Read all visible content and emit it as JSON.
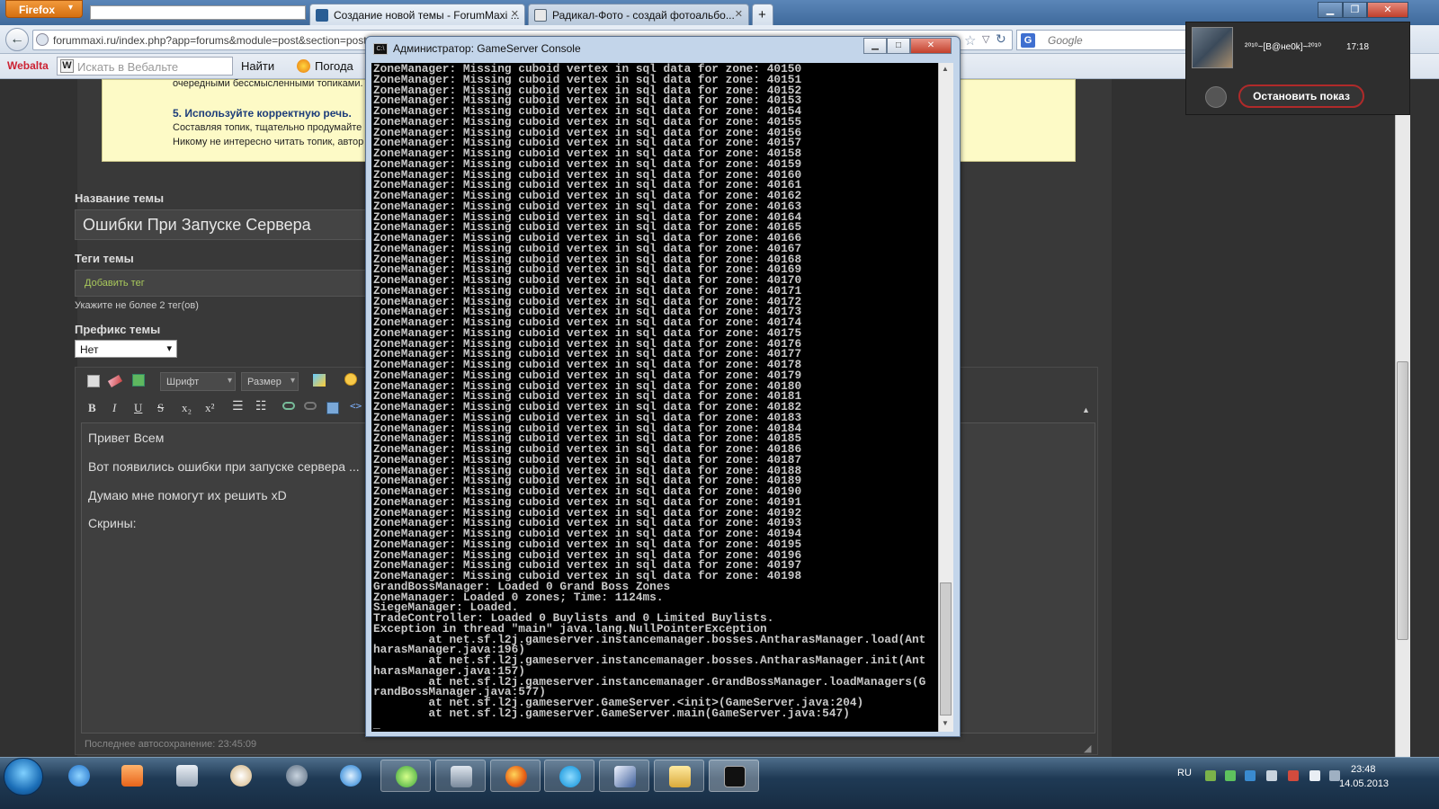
{
  "browser": {
    "menu_label": "Firefox",
    "tabs": [
      {
        "label": "Создание новой темы - ForumMaxi ..."
      },
      {
        "label": "Радикал-Фото - создай фотоальбо..."
      }
    ],
    "new_tab_label": "+",
    "url": "forummaxi.ru/index.php?app=forums&module=post&section=post",
    "search_engine": "Google",
    "search_placeholder": "Google",
    "toolbar": {
      "webalta": "Webalta",
      "webalta_placeholder": "Искать в Вебальте",
      "find": "Найти",
      "weather": "Погода"
    }
  },
  "forum": {
    "rules": {
      "line1": "очередными бессмысленными топиками.",
      "heading5": "5. Используйте корректную речь.",
      "line2": "Составляя топик, тщательно продумайте",
      "line3": "Никому не интересно читать топик, автор"
    },
    "title_label": "Название темы",
    "title_value": "Ошибки При Запуске Сервера",
    "tags_label": "Теги темы",
    "tags_placeholder": "Добавить тег",
    "tags_hint": "Укажите не более 2 тег(ов)",
    "prefix_label": "Префикс темы",
    "prefix_value": "Нет",
    "toolbar": {
      "font": "Шрифт",
      "size": "Размер",
      "bold": "B",
      "italic": "I",
      "underline": "U",
      "strike": "S",
      "sub": "x₂",
      "sup": "x²"
    },
    "body": [
      "Привет Всем",
      "Вот появились ошибки при запуске сервера ...",
      "Думаю мне помогут их решить xD",
      "Скрины:"
    ],
    "autosave": "Последнее автосохранение: 23:45:09"
  },
  "share": {
    "name": "²⁰¹⁰~[B@нe0k]~²⁰¹⁰",
    "time": "17:18",
    "stop_button": "Остановить показ"
  },
  "console": {
    "title": "Администратор:  GameServer Console",
    "lines": [
      "ZoneManager: Missing cuboid vertex in sql data for zone: 40150",
      "ZoneManager: Missing cuboid vertex in sql data for zone: 40151",
      "ZoneManager: Missing cuboid vertex in sql data for zone: 40152",
      "ZoneManager: Missing cuboid vertex in sql data for zone: 40153",
      "ZoneManager: Missing cuboid vertex in sql data for zone: 40154",
      "ZoneManager: Missing cuboid vertex in sql data for zone: 40155",
      "ZoneManager: Missing cuboid vertex in sql data for zone: 40156",
      "ZoneManager: Missing cuboid vertex in sql data for zone: 40157",
      "ZoneManager: Missing cuboid vertex in sql data for zone: 40158",
      "ZoneManager: Missing cuboid vertex in sql data for zone: 40159",
      "ZoneManager: Missing cuboid vertex in sql data for zone: 40160",
      "ZoneManager: Missing cuboid vertex in sql data for zone: 40161",
      "ZoneManager: Missing cuboid vertex in sql data for zone: 40162",
      "ZoneManager: Missing cuboid vertex in sql data for zone: 40163",
      "ZoneManager: Missing cuboid vertex in sql data for zone: 40164",
      "ZoneManager: Missing cuboid vertex in sql data for zone: 40165",
      "ZoneManager: Missing cuboid vertex in sql data for zone: 40166",
      "ZoneManager: Missing cuboid vertex in sql data for zone: 40167",
      "ZoneManager: Missing cuboid vertex in sql data for zone: 40168",
      "ZoneManager: Missing cuboid vertex in sql data for zone: 40169",
      "ZoneManager: Missing cuboid vertex in sql data for zone: 40170",
      "ZoneManager: Missing cuboid vertex in sql data for zone: 40171",
      "ZoneManager: Missing cuboid vertex in sql data for zone: 40172",
      "ZoneManager: Missing cuboid vertex in sql data for zone: 40173",
      "ZoneManager: Missing cuboid vertex in sql data for zone: 40174",
      "ZoneManager: Missing cuboid vertex in sql data for zone: 40175",
      "ZoneManager: Missing cuboid vertex in sql data for zone: 40176",
      "ZoneManager: Missing cuboid vertex in sql data for zone: 40177",
      "ZoneManager: Missing cuboid vertex in sql data for zone: 40178",
      "ZoneManager: Missing cuboid vertex in sql data for zone: 40179",
      "ZoneManager: Missing cuboid vertex in sql data for zone: 40180",
      "ZoneManager: Missing cuboid vertex in sql data for zone: 40181",
      "ZoneManager: Missing cuboid vertex in sql data for zone: 40182",
      "ZoneManager: Missing cuboid vertex in sql data for zone: 40183",
      "ZoneManager: Missing cuboid vertex in sql data for zone: 40184",
      "ZoneManager: Missing cuboid vertex in sql data for zone: 40185",
      "ZoneManager: Missing cuboid vertex in sql data for zone: 40186",
      "ZoneManager: Missing cuboid vertex in sql data for zone: 40187",
      "ZoneManager: Missing cuboid vertex in sql data for zone: 40188",
      "ZoneManager: Missing cuboid vertex in sql data for zone: 40189",
      "ZoneManager: Missing cuboid vertex in sql data for zone: 40190",
      "ZoneManager: Missing cuboid vertex in sql data for zone: 40191",
      "ZoneManager: Missing cuboid vertex in sql data for zone: 40192",
      "ZoneManager: Missing cuboid vertex in sql data for zone: 40193",
      "ZoneManager: Missing cuboid vertex in sql data for zone: 40194",
      "ZoneManager: Missing cuboid vertex in sql data for zone: 40195",
      "ZoneManager: Missing cuboid vertex in sql data for zone: 40196",
      "ZoneManager: Missing cuboid vertex in sql data for zone: 40197",
      "ZoneManager: Missing cuboid vertex in sql data for zone: 40198",
      "GrandBossManager: Loaded 0 Grand Boss Zones",
      "ZoneManager: Loaded 0 zones; Time: 1124ms.",
      "SiegeManager: Loaded.",
      "TradeController: Loaded 0 Buylists and 0 Limited Buylists.",
      "Exception in thread \"main\" java.lang.NullPointerException",
      "        at net.sf.l2j.gameserver.instancemanager.bosses.AntharasManager.load(Ant",
      "harasManager.java:196)",
      "        at net.sf.l2j.gameserver.instancemanager.bosses.AntharasManager.init(Ant",
      "harasManager.java:157)",
      "        at net.sf.l2j.gameserver.instancemanager.GrandBossManager.loadManagers(G",
      "randBossManager.java:577)",
      "        at net.sf.l2j.gameserver.GameServer.<init>(GameServer.java:204)",
      "        at net.sf.l2j.gameserver.GameServer.main(GameServer.java:547)",
      "_"
    ]
  },
  "taskbar": {
    "lang": "RU",
    "time": "23:48",
    "date": "14.05.2013"
  }
}
